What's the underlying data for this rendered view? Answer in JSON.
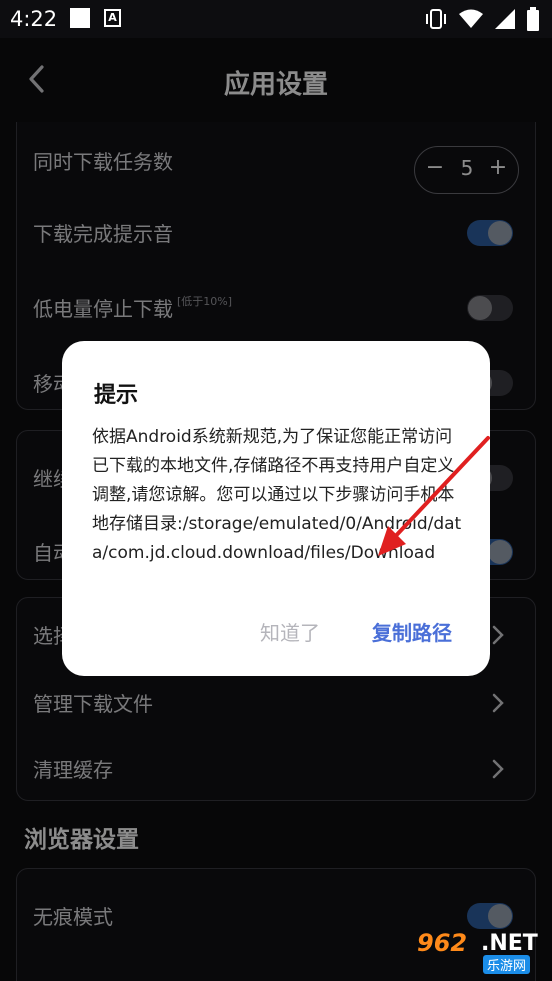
{
  "status_bar": {
    "time": "4:22",
    "notif_letter": "A"
  },
  "app_bar": {
    "title": "应用设置"
  },
  "download_card": {
    "items": [
      {
        "label": "同时下载任务数",
        "stepper_value": "5",
        "minus": "−",
        "plus": "+"
      },
      {
        "label": "下载完成提示音",
        "toggle": true
      },
      {
        "label": "低电量停止下载",
        "note": "[低于10%]",
        "toggle": false
      },
      {
        "label": "移动",
        "toggle": false
      }
    ]
  },
  "second_card": {
    "items": [
      {
        "label": "继续",
        "toggle": false
      },
      {
        "label": "自动",
        "toggle": true
      }
    ]
  },
  "file_card": {
    "items": [
      {
        "label": "选择"
      },
      {
        "label": "管理下载文件"
      },
      {
        "label": "清理缓存"
      }
    ]
  },
  "browser_section": {
    "title": "浏览器设置",
    "items": [
      {
        "label": "无痕模式",
        "toggle": true
      }
    ]
  },
  "dialog": {
    "title": "提示",
    "body": "依据Android系统新规范,为了保证您能正常访问已下载的本地文件,存储路径不再支持用户自定义调整,请您谅解。您可以通过以下步骤访问手机本地存储目录:/storage/emulated/0/Android/data/com.jd.cloud.download/files/Download",
    "dismiss_label": "知道了",
    "copy_label": "复制路径"
  },
  "watermark": {
    "brand": "962",
    "net": ".NET",
    "sub": "乐游网"
  },
  "colors": {
    "accent": "#4a6fd8",
    "toggle_on": "#2f5fa3",
    "arrow": "#e02020"
  }
}
